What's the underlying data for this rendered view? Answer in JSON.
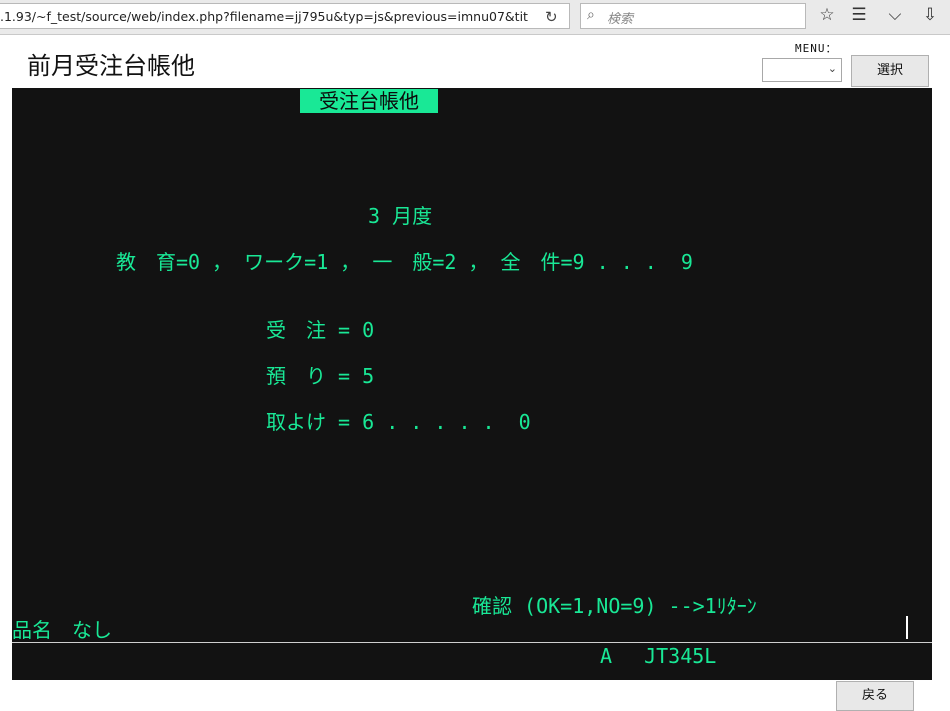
{
  "browser": {
    "url": ".1.93/~f_test/source/web/index.php?filename=jj795u&typ=js&previous=imnu07&tit",
    "search_placeholder": "検索",
    "icons": [
      "reload-icon",
      "search-icon",
      "bookmark-star-icon",
      "reader-icon",
      "pocket-icon",
      "download-icon"
    ]
  },
  "header": {
    "title": "前月受注台帳他",
    "menu_label": "MENU：",
    "menu_selected": "",
    "select_button": "選択"
  },
  "terminal": {
    "heading": "受注台帳他",
    "month_line": "3 月度",
    "category_line": "教　育=0 ， ワーク=1 ， 一　般=2 ， 全　件=9 . . .  9",
    "order_line": "受　注 = 0",
    "deposit_line": "預　り = 5",
    "cancel_line": "取よけ = 6 . . . . .  0",
    "confirm_line": "確認 (OK=1,NO=9) -->1ﾘﾀｰﾝ",
    "product_line": "品名　なし",
    "status_line": "A　 JT345L"
  },
  "footer": {
    "back_button": "戻る"
  },
  "colors": {
    "terminal_bg": "#121212",
    "terminal_text": "#19e896"
  }
}
